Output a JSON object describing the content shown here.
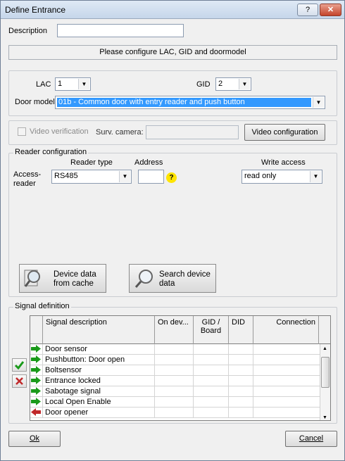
{
  "window": {
    "title": "Define Entrance",
    "help_label": "?",
    "close_label": "✕"
  },
  "description": {
    "label": "Description",
    "value": ""
  },
  "banner": "Please configure LAC, GID and doormodel",
  "lac": {
    "label": "LAC",
    "value": "1"
  },
  "gid": {
    "label": "GID",
    "value": "2"
  },
  "door_model": {
    "label": "Door model",
    "value": "01b - Common door with entry reader and push button"
  },
  "video": {
    "checkbox_label": "Video verification",
    "camera_label": "Surv. camera:",
    "camera_value": "",
    "config_button": "Video configuration"
  },
  "reader": {
    "group_label": "Reader configuration",
    "reader_type_header": "Reader type",
    "address_header": "Address",
    "write_access_header": "Write access",
    "row_label": "Access-\nreader",
    "reader_type_value": "RS485",
    "address_value": "",
    "address_hint": "?",
    "write_access_value": "read only",
    "device_cache_button": "Device data\nfrom cache",
    "search_device_button": "Search device\ndata"
  },
  "signals": {
    "group_label": "Signal definition",
    "columns": [
      "Signal description",
      "On dev...",
      "GID /\nBoard",
      "DID",
      "Connection"
    ],
    "rows": [
      {
        "desc": "Door sensor",
        "type": "input"
      },
      {
        "desc": "Pushbutton: Door open",
        "type": "input"
      },
      {
        "desc": "Boltsensor",
        "type": "input"
      },
      {
        "desc": "Entrance locked",
        "type": "input"
      },
      {
        "desc": "Sabotage signal",
        "type": "input"
      },
      {
        "desc": "Local Open Enable",
        "type": "input"
      },
      {
        "desc": "Door opener",
        "type": "output"
      }
    ],
    "accept_icon": "check-icon",
    "delete_icon": "delete-x-icon"
  },
  "footer": {
    "ok_label": "Ok",
    "cancel_label": "Cancel"
  },
  "colors": {
    "accent_selection": "#3399ff",
    "input_arrow_green": "#1a9a1a",
    "output_arrow_red": "#c0282a",
    "hint_yellow": "#ffe400"
  }
}
